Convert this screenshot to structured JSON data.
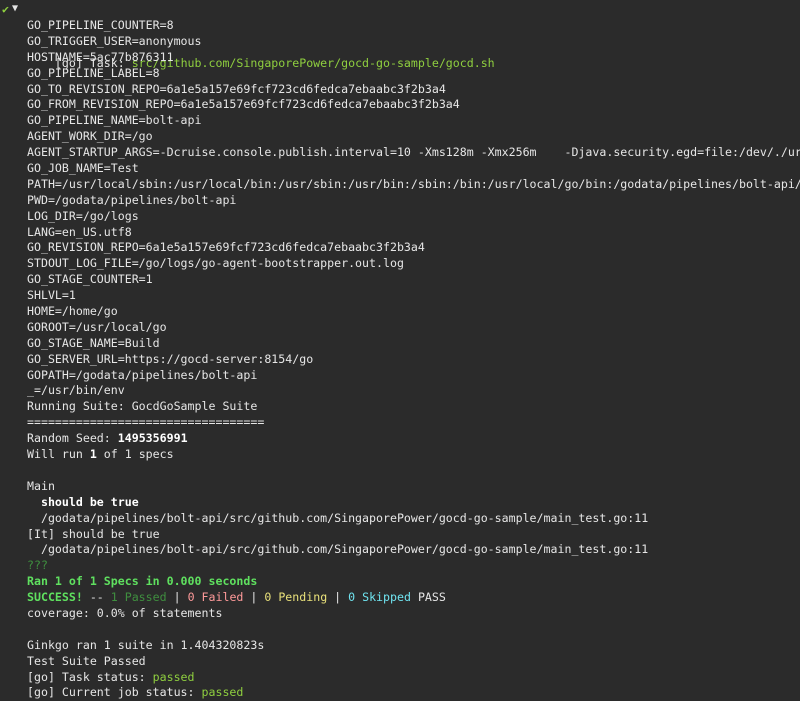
{
  "colors": {
    "background": "#2b2b2b",
    "text": "#e6e6e6",
    "success_green": "#8fcf3f",
    "bright_green": "#5fe05f",
    "failed": "#ff9a9a",
    "pending": "#e8e07a",
    "skipped": "#6fe3ef"
  },
  "task": {
    "prefix": "[go] Task: ",
    "path": "src/github.com/SingaporePower/gocd-go-sample/gocd.sh",
    "icons": [
      "check-icon",
      "caret-down-icon"
    ]
  },
  "env_lines": [
    "GO_PIPELINE_COUNTER=8",
    "GO_TRIGGER_USER=anonymous",
    "HOSTNAME=5ac77b876311",
    "GO_PIPELINE_LABEL=8",
    "GO_TO_REVISION_REPO=6a1e5a157e69fcf723cd6fedca7ebaabc3f2b3a4",
    "GO_FROM_REVISION_REPO=6a1e5a157e69fcf723cd6fedca7ebaabc3f2b3a4",
    "GO_PIPELINE_NAME=bolt-api",
    "AGENT_WORK_DIR=/go",
    "AGENT_STARTUP_ARGS=-Dcruise.console.publish.interval=10 -Xms128m -Xmx256m    -Djava.security.egd=file:/dev/./urandom",
    "GO_JOB_NAME=Test",
    "PATH=/usr/local/sbin:/usr/local/bin:/usr/sbin:/usr/bin:/sbin:/bin:/usr/local/go/bin:/godata/pipelines/bolt-api/bin",
    "PWD=/godata/pipelines/bolt-api",
    "LOG_DIR=/go/logs",
    "LANG=en_US.utf8",
    "GO_REVISION_REPO=6a1e5a157e69fcf723cd6fedca7ebaabc3f2b3a4",
    "STDOUT_LOG_FILE=/go/logs/go-agent-bootstrapper.out.log",
    "GO_STAGE_COUNTER=1",
    "SHLVL=1",
    "HOME=/home/go",
    "GOROOT=/usr/local/go",
    "GO_STAGE_NAME=Build",
    "GO_SERVER_URL=https://gocd-server:8154/go",
    "GOPATH=/godata/pipelines/bolt-api",
    "_=/usr/bin/env"
  ],
  "suite": {
    "running": "Running Suite: GocdGoSample Suite",
    "separator": "==================================",
    "seed_label": "Random Seed: ",
    "seed_value": "1495356991",
    "will_run_prefix": "Will run ",
    "will_run_count": "1",
    "will_run_suffix": " of 1 specs",
    "blank": " ",
    "main": "Main",
    "should_be_true": "  should be true",
    "test_path_1": "  /godata/pipelines/bolt-api/src/github.com/SingaporePower/gocd-go-sample/main_test.go:11",
    "it_line": "[It] should be true",
    "test_path_2": "  /godata/pipelines/bolt-api/src/github.com/SingaporePower/gocd-go-sample/main_test.go:11",
    "question": "???",
    "ran_specs": "Ran 1 of 1 Specs in 0.000 seconds",
    "success_label": "SUCCESS!",
    "dashes": " -- ",
    "passed": "1 Passed",
    "sep1": " | ",
    "failed": "0 Failed",
    "sep2": " | ",
    "pending": "0 Pending",
    "sep3": " | ",
    "skipped": "0 Skipped",
    "pass_word": " PASS",
    "coverage": "coverage: 0.0% of statements",
    "ginkgo_ran": "Ginkgo ran 1 suite in 1.404320823s",
    "suite_passed": "Test Suite Passed"
  },
  "status": {
    "task_status_label": "[go] Task status: ",
    "task_status_value": "passed",
    "job_status_label": "[go] Current job status: ",
    "job_status_value": "passed"
  }
}
